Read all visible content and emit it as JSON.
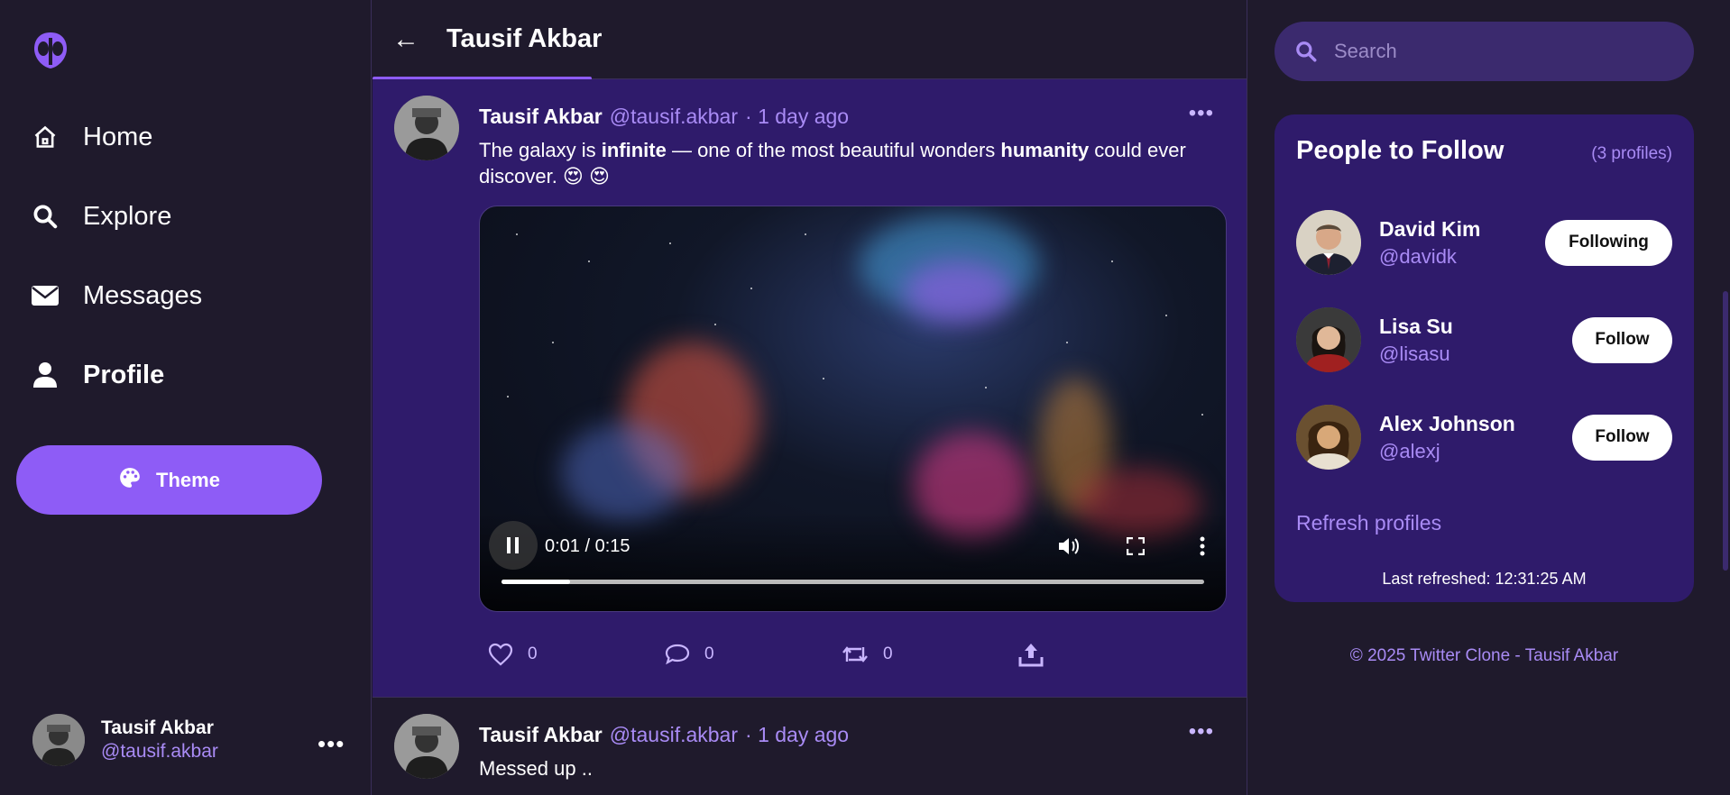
{
  "sidebar": {
    "logo_icon": "alien-logo-icon",
    "items": [
      {
        "label": "Home",
        "icon": "home-icon"
      },
      {
        "label": "Explore",
        "icon": "search-icon"
      },
      {
        "label": "Messages",
        "icon": "envelope-icon"
      },
      {
        "label": "Profile",
        "icon": "user-icon",
        "active": true
      }
    ],
    "theme_label": "Theme",
    "user": {
      "name": "Tausif Akbar",
      "handle": "@tausif.akbar"
    },
    "more": "•••"
  },
  "header": {
    "back": "←",
    "title": "Tausif Akbar"
  },
  "posts": [
    {
      "name": "Tausif Akbar",
      "handle": "@tausif.akbar",
      "time": "· 1 day ago",
      "more": "•••",
      "text_parts": [
        "The galaxy is ",
        "infinite",
        " — one of the most beautiful wonders ",
        "humanity",
        " could ever discover. 😍 😍"
      ],
      "video": {
        "time": "0:01 / 0:15",
        "progress_fraction": 0.097
      },
      "actions": {
        "likes": "0",
        "comments": "0",
        "retweets": "0"
      }
    },
    {
      "name": "Tausif Akbar",
      "handle": "@tausif.akbar",
      "time": "· 1 day ago",
      "more": "•••",
      "text": "Messed up .."
    }
  ],
  "search": {
    "placeholder": "Search"
  },
  "follow": {
    "title": "People to Follow",
    "count": "(3 profiles)",
    "people": [
      {
        "name": "David Kim",
        "handle": "@davidk",
        "button": "Following"
      },
      {
        "name": "Lisa Su",
        "handle": "@lisasu",
        "button": "Follow"
      },
      {
        "name": "Alex Johnson",
        "handle": "@alexj",
        "button": "Follow"
      }
    ],
    "refresh": "Refresh profiles",
    "last_refreshed": "Last refreshed: 12:31:25 AM"
  },
  "footer": "© 2025 Twitter Clone - Tausif Akbar",
  "colors": {
    "accent": "#8e5cf6",
    "card": "#2f1b6b",
    "bg": "#1f1a2c",
    "link": "#a98bf5"
  }
}
